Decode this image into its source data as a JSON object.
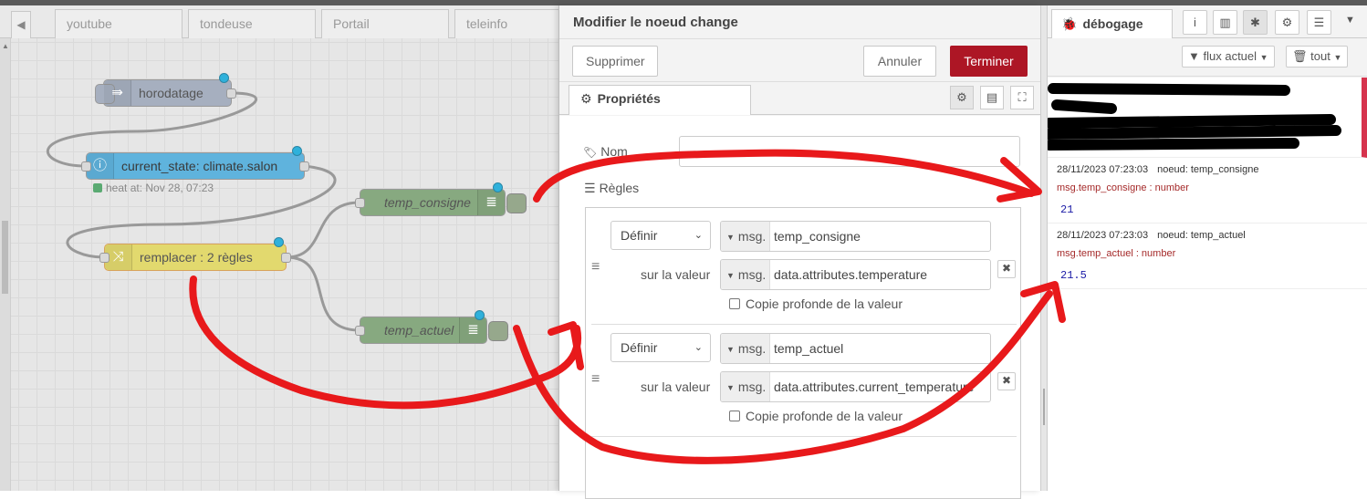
{
  "workspace": {
    "tabs": [
      "youtube",
      "tondeuse",
      "Portail",
      "teleinfo"
    ],
    "nodes": {
      "horodatage": "horodatage",
      "current_state": "current_state: climate.salon",
      "current_state_status": "heat at: Nov 28, 07:23",
      "remplacer": "remplacer : 2 règles",
      "temp_consigne": "temp_consigne",
      "temp_actuel": "temp_actuel"
    }
  },
  "editor": {
    "title": "Modifier le noeud change",
    "delete_label": "Supprimer",
    "cancel_label": "Annuler",
    "done_label": "Terminer",
    "properties_tab": "Propriétés",
    "name_label": "Nom",
    "rules_label": "Règles",
    "rules": [
      {
        "action": "Définir",
        "target_type": "msg.",
        "target": "temp_consigne",
        "to_label": "sur la valeur",
        "value_type": "msg.",
        "value": "data.attributes.temperature",
        "deep_copy": "Copie profonde de la valeur"
      },
      {
        "action": "Définir",
        "target_type": "msg.",
        "target": "temp_actuel",
        "to_label": "sur la valeur",
        "value_type": "msg.",
        "value": "data.attributes.current_temperature",
        "deep_copy": "Copie profonde de la valeur"
      }
    ]
  },
  "sidebar": {
    "debug_tab": "débogage",
    "filter_label": "flux actuel",
    "clear_label": "tout",
    "messages": [
      {
        "timestamp": "28/11/2023 07:23:03",
        "node": "noeud: temp_consigne",
        "topic": "msg.temp_consigne : number",
        "value": "21"
      },
      {
        "timestamp": "28/11/2023 07:23:03",
        "node": "noeud: temp_actuel",
        "topic": "msg.temp_actuel : number",
        "value": "21.5"
      }
    ]
  },
  "colors": {
    "accent_red": "#ad1625",
    "annotation_red": "#e8191b",
    "inject_node": "#a6afbf",
    "ha_node": "#5fb3dd",
    "change_node": "#e2d96e",
    "debug_node": "#87a980",
    "port_dot": "#2fb1db"
  }
}
